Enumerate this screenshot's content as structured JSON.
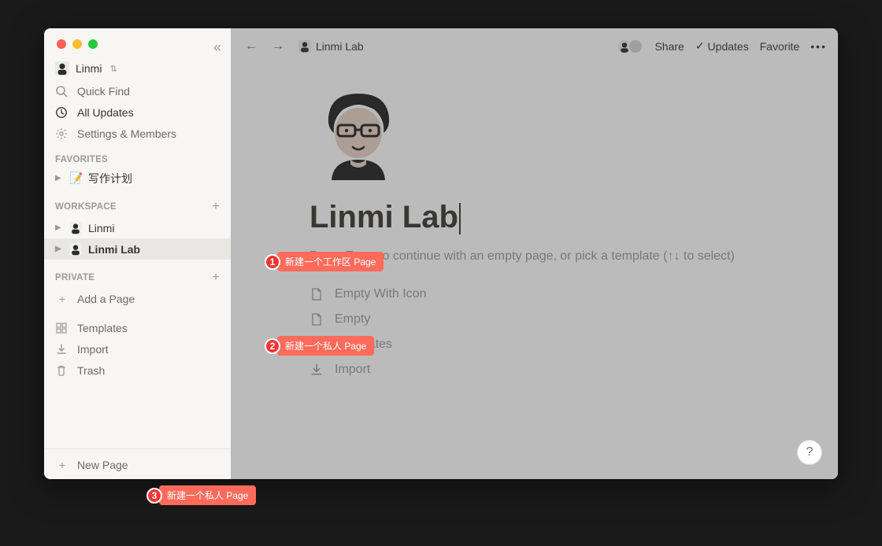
{
  "window": {
    "workspace_name": "Linmi"
  },
  "sidebar": {
    "quick_find": "Quick Find",
    "all_updates": "All Updates",
    "settings_members": "Settings & Members",
    "favorites_label": "FAVORITES",
    "favorites": [
      {
        "icon": "📝",
        "label": "写作计划"
      }
    ],
    "workspace_label": "WORKSPACE",
    "workspace_items": [
      {
        "label": "Linmi",
        "selected": false
      },
      {
        "label": "Linmi Lab",
        "selected": true
      }
    ],
    "private_label": "PRIVATE",
    "add_page": "Add a Page",
    "templates": "Templates",
    "import": "Import",
    "trash": "Trash",
    "new_page": "New Page"
  },
  "topbar": {
    "breadcrumb": "Linmi Lab",
    "share": "Share",
    "updates": "Updates",
    "favorite": "Favorite"
  },
  "page": {
    "title": "Linmi Lab",
    "hint": "Press Enter to continue with an empty page, or pick a template (↑↓ to select)",
    "templates": [
      {
        "icon": "page-icon",
        "label": "Empty With Icon"
      },
      {
        "icon": "page-icon",
        "label": "Empty"
      },
      {
        "icon": "templates-icon",
        "label": "Templates"
      },
      {
        "icon": "import-icon",
        "label": "Import"
      }
    ]
  },
  "help": "?",
  "annotations": [
    {
      "num": "1",
      "label": "新建一个工作区 Page"
    },
    {
      "num": "2",
      "label": "新建一个私人 Page"
    },
    {
      "num": "3",
      "label": "新建一个私人 Page"
    }
  ]
}
